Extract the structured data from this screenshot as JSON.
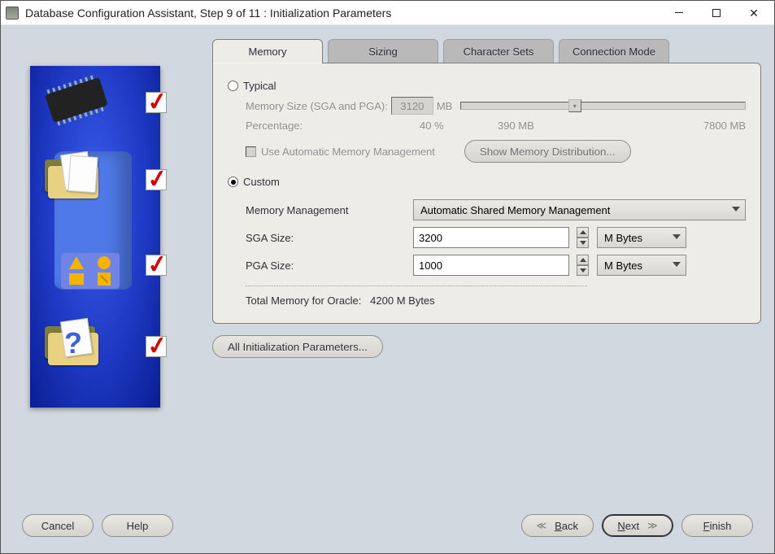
{
  "window": {
    "title": "Database Configuration Assistant, Step 9 of 11 : Initialization Parameters"
  },
  "tabs": {
    "memory": "Memory",
    "sizing": "Sizing",
    "char": "Character Sets",
    "conn": "Connection Mode"
  },
  "typical": {
    "label": "Typical",
    "mem_size_label": "Memory Size (SGA and PGA):",
    "mem_size_value": "3120",
    "mem_size_unit": "MB",
    "pct_label": "Percentage:",
    "pct_value": "40 %",
    "slider_min": "390 MB",
    "slider_max": "7800 MB",
    "amm_label": "Use Automatic Memory Management",
    "show_dist": "Show Memory Distribution..."
  },
  "custom": {
    "label": "Custom",
    "mm_label": "Memory Management",
    "mm_value": "Automatic Shared Memory Management",
    "sga_label": "SGA Size:",
    "sga_value": "3200",
    "sga_unit": "M Bytes",
    "pga_label": "PGA Size:",
    "pga_value": "1000",
    "pga_unit": "M Bytes",
    "total_label": "Total Memory for Oracle:",
    "total_value": "4200 M Bytes"
  },
  "below": {
    "all_params": "All Initialization Parameters..."
  },
  "footer": {
    "cancel": "Cancel",
    "help": "Help",
    "back": "Back",
    "next": "Next",
    "finish": "Finish"
  }
}
